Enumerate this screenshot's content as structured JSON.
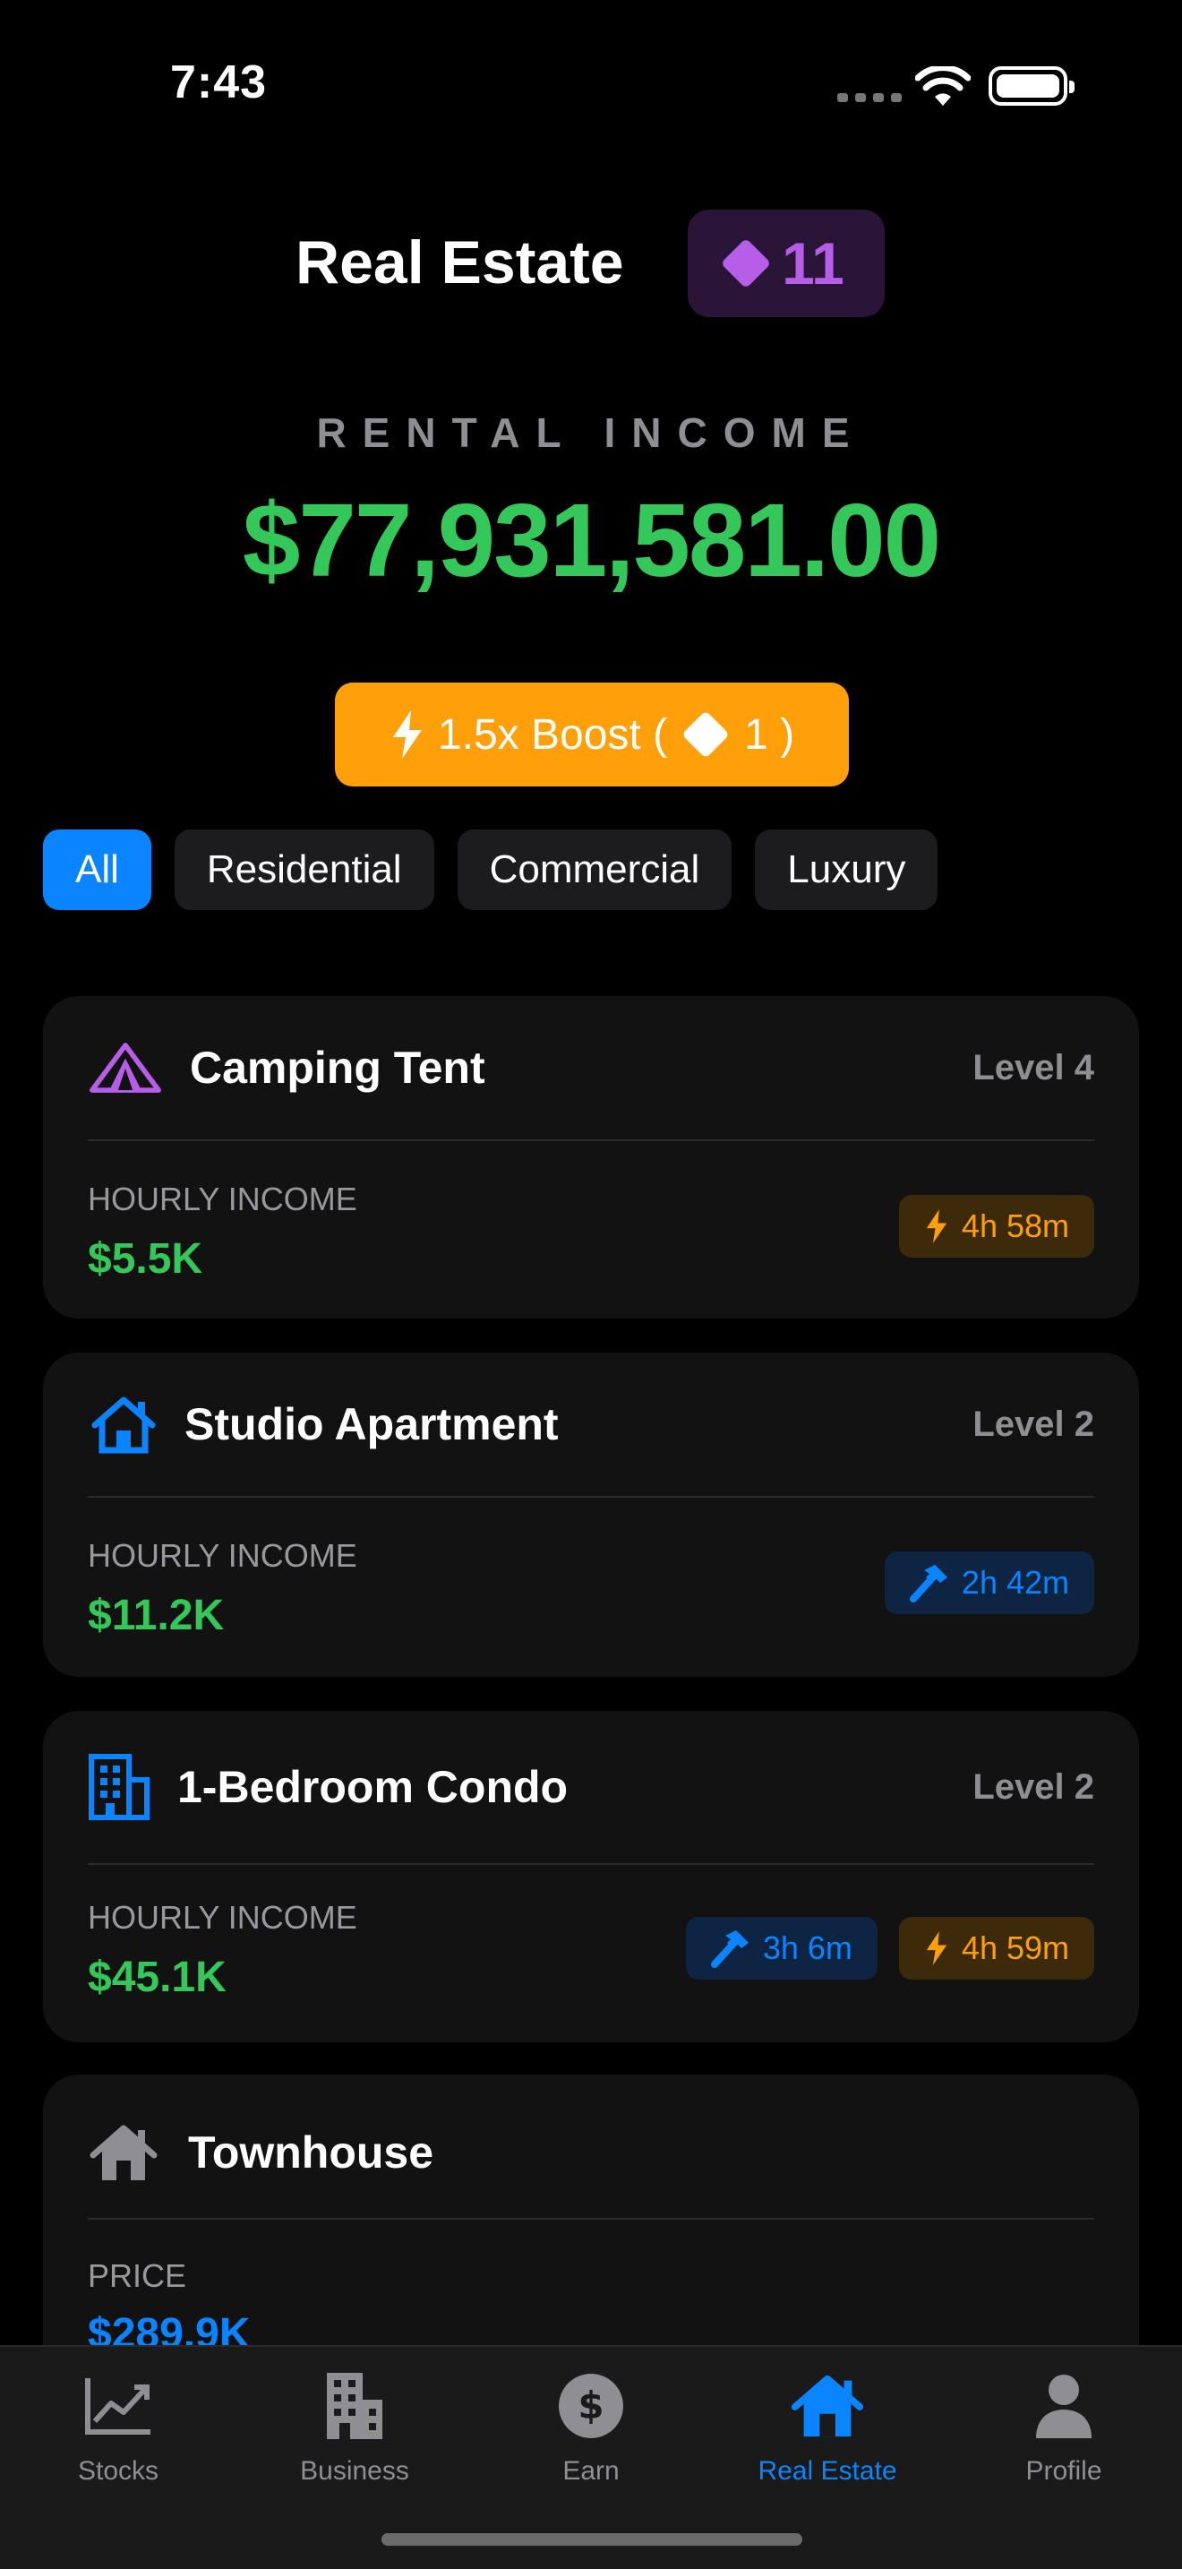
{
  "status_bar": {
    "time": "7:43"
  },
  "header": {
    "title": "Real Estate",
    "gems": "11"
  },
  "income": {
    "label": "RENTAL INCOME",
    "value": "$77,931,581.00"
  },
  "boost": {
    "prefix": "1.5x Boost (",
    "cost": "1 )"
  },
  "filters": [
    "All",
    "Residential",
    "Commercial",
    "Luxury"
  ],
  "properties": [
    {
      "name": "Camping Tent",
      "level": "Level 4",
      "label": "HOURLY INCOME",
      "value": "$5.5K",
      "icon": "tent-icon",
      "timers": [
        {
          "type": "boost",
          "text": "4h 58m"
        }
      ]
    },
    {
      "name": "Studio Apartment",
      "level": "Level 2",
      "label": "HOURLY INCOME",
      "value": "$11.2K",
      "icon": "house-icon",
      "timers": [
        {
          "type": "build",
          "text": "2h 42m"
        }
      ]
    },
    {
      "name": "1-Bedroom Condo",
      "level": "Level 2",
      "label": "HOURLY INCOME",
      "value": "$45.1K",
      "icon": "building-icon",
      "timers": [
        {
          "type": "build",
          "text": "3h 6m"
        },
        {
          "type": "boost",
          "text": "4h 59m"
        }
      ]
    },
    {
      "name": "Townhouse",
      "level": "",
      "label": "PRICE",
      "value": "$289.9K",
      "icon": "townhouse-icon",
      "timers": []
    }
  ],
  "tabs": [
    {
      "label": "Stocks",
      "icon": "chart-icon"
    },
    {
      "label": "Business",
      "icon": "building-icon"
    },
    {
      "label": "Earn",
      "icon": "dollar-icon"
    },
    {
      "label": "Real Estate",
      "icon": "house-icon"
    },
    {
      "label": "Profile",
      "icon": "person-icon"
    }
  ],
  "colors": {
    "accent": "#0a84ff",
    "income": "#34c759",
    "boost": "#ff9f0a",
    "gem": "#b65ee8"
  }
}
